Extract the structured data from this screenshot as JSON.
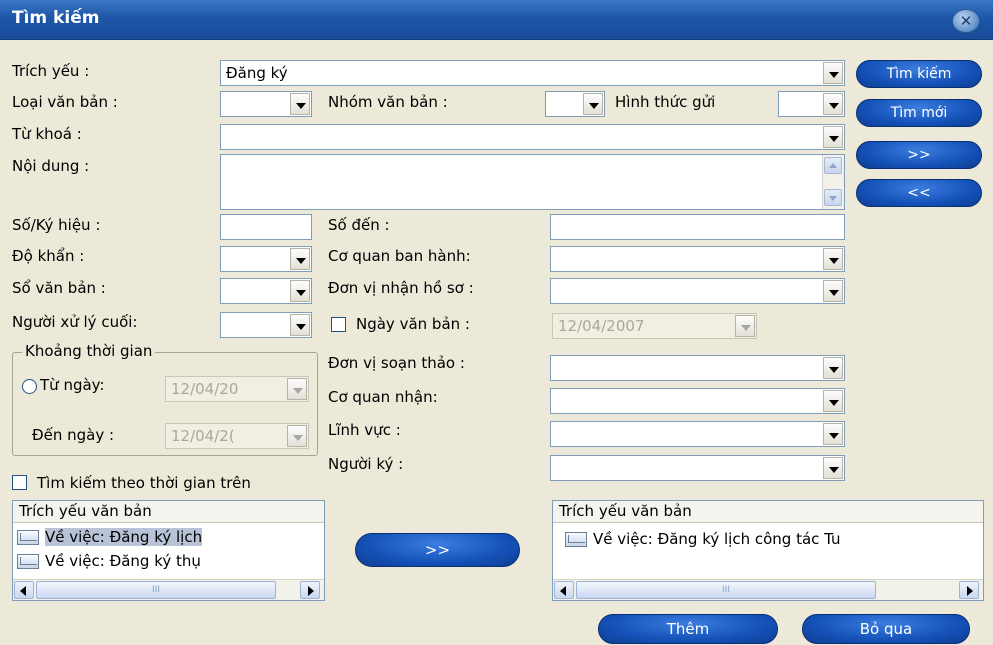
{
  "window": {
    "title": "Tìm kiếm"
  },
  "labels": {
    "trich_yeu": "Trích yếu :",
    "loai_van_ban": "Loại văn bản :",
    "nhom_van_ban": "Nhóm văn bản :",
    "hinh_thuc_gui": "Hình thức gửi",
    "tu_khoa": "Từ khoá :",
    "noi_dung": "Nội dung :",
    "so_ky_hieu": "Số/Ký hiệu :",
    "so_den": "Số đến :",
    "do_khan": "Độ khẩn :",
    "co_quan_ban_hanh": "Cơ quan ban hành:",
    "so_van_ban": "Sổ văn bản :",
    "don_vi_nhan_ho_so": "Đơn vị nhận hồ sơ :",
    "nguoi_xu_ly_cuoi": "Người xử lý cuối:",
    "ngay_van_ban": "Ngày văn bản :",
    "khoang_thoi_gian": "Khoảng thời gian",
    "tu_ngay": "Từ ngày:",
    "den_ngay": "Đến ngày :",
    "don_vi_soan_thao": "Đơn vị soạn thảo :",
    "co_quan_nhan": "Cơ quan nhận:",
    "linh_vuc": "Lĩnh vực :",
    "nguoi_ky": "Người ký :",
    "tim_kiem_theo_thoi_gian": "Tìm kiếm theo thời gian trên"
  },
  "values": {
    "trich_yeu": "Đăng ký",
    "ngay_van_ban": "12/04/2007",
    "tu_ngay": "12/04/20",
    "den_ngay": "12/04/2("
  },
  "buttons": {
    "tim_kiem": "Tìm kiếm",
    "tim_moi": "Tìm mới",
    "next": ">>",
    "prev": "<<",
    "transfer": ">>",
    "them": "Thêm",
    "bo_qua": "Bỏ qua"
  },
  "left_list": {
    "header": "Trích yếu văn bản",
    "items": [
      "Về việc: Đăng ký lịch",
      "Về việc: Đăng ký thụ"
    ]
  },
  "right_list": {
    "header": "Trích yếu văn bản",
    "items": [
      "Về việc: Đăng ký lịch công tác Tu"
    ]
  },
  "icons": {
    "close": "close-icon",
    "envelope": "envelope-icon"
  }
}
